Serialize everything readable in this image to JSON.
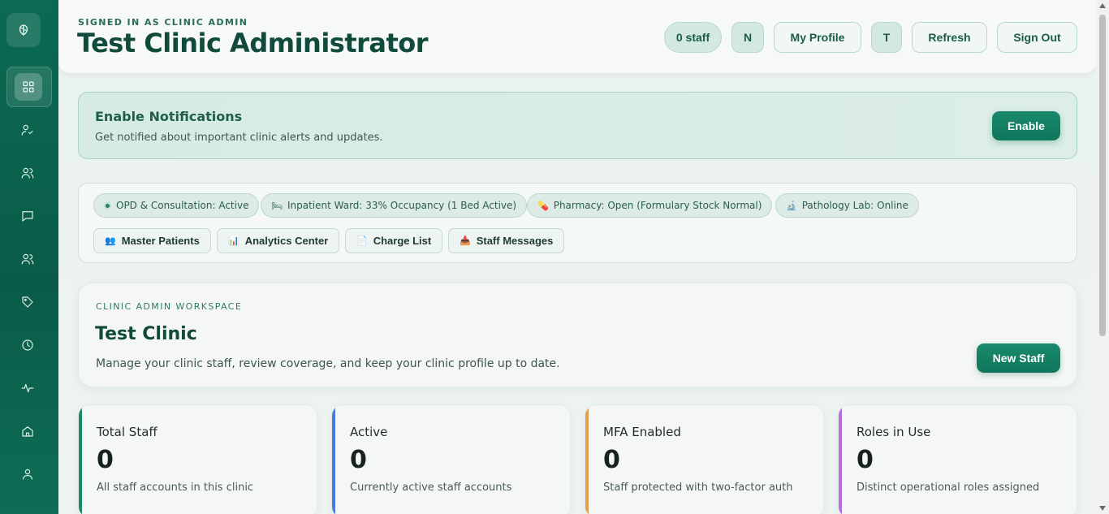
{
  "header": {
    "eyebrow": "SIGNED IN AS CLINIC ADMIN",
    "title": "Test Clinic Administrator",
    "staff_count": "0 staff",
    "avatar_n": "N",
    "my_profile": "My Profile",
    "avatar_t": "T",
    "refresh": "Refresh",
    "sign_out": "Sign Out"
  },
  "notification": {
    "title": "Enable Notifications",
    "text": "Get notified about important clinic alerts and updates.",
    "button": "Enable"
  },
  "status": {
    "opd": "OPD & Consultation: Active",
    "inpatient": "Inpatient Ward: 33% Occupancy (1 Bed Active)",
    "pharmacy": "Pharmacy: Open (Formulary Stock Normal)",
    "pathology": "Pathology Lab: Online"
  },
  "quick_links": {
    "master_patients": "Master Patients",
    "analytics_center": "Analytics Center",
    "charge_list": "Charge List",
    "staff_messages": "Staff Messages"
  },
  "workspace": {
    "eyebrow": "CLINIC ADMIN WORKSPACE",
    "title": "Test Clinic",
    "text": "Manage your clinic staff, review coverage, and keep your clinic profile up to date.",
    "button": "New Staff"
  },
  "stats": [
    {
      "label": "Total Staff",
      "value": "0",
      "sub": "All staff accounts in this clinic",
      "color": "#1a8a6c"
    },
    {
      "label": "Active",
      "value": "0",
      "sub": "Currently active staff accounts",
      "color": "#4a7be0"
    },
    {
      "label": "MFA Enabled",
      "value": "0",
      "sub": "Staff protected with two-factor auth",
      "color": "#e89a4c"
    },
    {
      "label": "Roles in Use",
      "value": "0",
      "sub": "Distinct operational roles assigned",
      "color": "#b46ee0"
    }
  ],
  "sidebar": {
    "icons": [
      "dashboard-icon",
      "user-check-icon",
      "users-icon",
      "message-icon",
      "staff-icon",
      "tag-icon",
      "clock-icon",
      "activity-icon",
      "home-icon",
      "user-icon"
    ]
  }
}
